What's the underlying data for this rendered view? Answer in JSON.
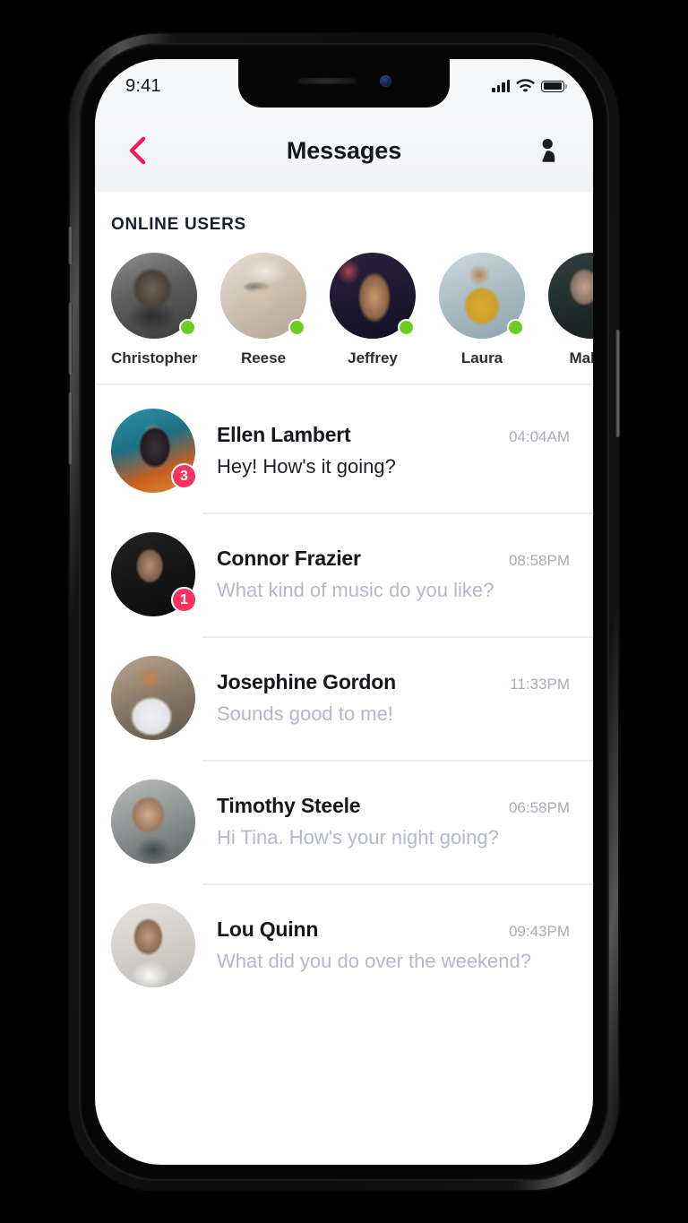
{
  "device": {
    "notch_speaker": "speaker-grille",
    "notch_camera": "front-camera"
  },
  "status_bar": {
    "time": "9:41",
    "signal_icon": "cellular-signal-icon",
    "signal_bars": 4,
    "wifi_icon": "wifi-icon",
    "battery_icon": "battery-icon",
    "battery_level": 100
  },
  "nav_header": {
    "back_icon": "chevron-left-icon",
    "title": "Messages",
    "profile_icon": "person-icon",
    "accent_color": "#F4165A",
    "background": "#F4F5F7"
  },
  "online_section": {
    "title": "ONLINE USERS",
    "online_dot_color": "#6DCC21",
    "users": [
      {
        "name": "Christopher",
        "online": true,
        "avatar": "avatar-christopher"
      },
      {
        "name": "Reese",
        "online": true,
        "avatar": "avatar-reese"
      },
      {
        "name": "Jeffrey",
        "online": true,
        "avatar": "avatar-jeffrey"
      },
      {
        "name": "Laura",
        "online": true,
        "avatar": "avatar-laura"
      },
      {
        "name": "Maldo",
        "online": true,
        "avatar": "avatar-maldo"
      }
    ]
  },
  "messages": {
    "badge_color": "#F8335F",
    "rows": [
      {
        "name": "Ellen Lambert",
        "time": "04:04AM",
        "preview": "Hey! How's it going?",
        "badge": "3",
        "unread": true,
        "avatar": "avatar-ellen"
      },
      {
        "name": "Connor Frazier",
        "time": "08:58PM",
        "preview": "What kind of music do you like?",
        "badge": "1",
        "unread": false,
        "avatar": "avatar-connor"
      },
      {
        "name": "Josephine Gordon",
        "time": "11:33PM",
        "preview": "Sounds good to me!",
        "badge": null,
        "unread": false,
        "avatar": "avatar-josephine"
      },
      {
        "name": "Timothy Steele",
        "time": "06:58PM",
        "preview": "Hi Tina. How's your night going?",
        "badge": null,
        "unread": false,
        "avatar": "avatar-timothy"
      },
      {
        "name": "Lou Quinn",
        "time": "09:43PM",
        "preview": "What did you do over the weekend?",
        "badge": null,
        "unread": false,
        "avatar": "avatar-lou"
      }
    ]
  }
}
